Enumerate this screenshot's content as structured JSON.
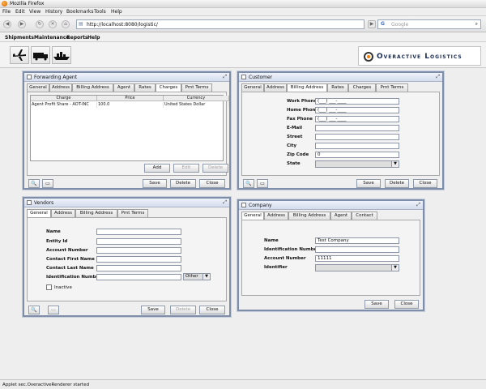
{
  "browser": {
    "window_title": "Mozilla Firefox",
    "menu": [
      "File",
      "Edit",
      "View",
      "History",
      "Bookmarks",
      "Tools",
      "Help"
    ],
    "url": "http://localhost:8080/logistic/",
    "search_placeholder": "Google"
  },
  "app": {
    "menu": [
      "Shipments",
      "Maintenance",
      "Reports",
      "Help"
    ],
    "logo_text": "Overactive Logistics",
    "toolbar_icons": [
      "airplane-icon",
      "truck-icon",
      "ship-icon"
    ]
  },
  "forwarding_agent": {
    "title": "Forwarding Agent",
    "tabs": [
      "General",
      "Address",
      "Billing Address",
      "Agent",
      "Rates",
      "Charges",
      "Pmt Terms"
    ],
    "selected_tab": "Charges",
    "columns": [
      "Charge",
      "Price",
      "Currency"
    ],
    "rows": [
      [
        "Agent Profit Share - AOT-INC",
        "100.0",
        "United States Dollar"
      ]
    ],
    "buttons": {
      "add": "Add",
      "edit": "Edit",
      "delete": "Delete"
    },
    "footer": {
      "save": "Save",
      "delete": "Delete",
      "close": "Close"
    }
  },
  "customer": {
    "title": "Customer",
    "tabs": [
      "General",
      "Address",
      "Billing Address",
      "Rates",
      "Charges",
      "Pmt Terms"
    ],
    "selected_tab": "Billing Address",
    "fields": {
      "work_phone_label": "Work Phone",
      "work_phone_value": "(___) ___-____",
      "home_phone_label": "Home Phone",
      "home_phone_value": "(___) ___-____",
      "fax_phone_label": "Fax Phone",
      "fax_phone_value": "(___) ___-____",
      "email_label": "E-Mail",
      "street_label": "Street",
      "city_label": "City",
      "zip_label": "Zip Code",
      "zip_value": "0",
      "state_label": "State"
    },
    "footer": {
      "save": "Save",
      "delete": "Delete",
      "close": "Close"
    }
  },
  "vendors": {
    "title": "Vendors",
    "tabs": [
      "General",
      "Address",
      "Billing Address",
      "Pmt Terms"
    ],
    "selected_tab": "General",
    "fields": {
      "name_label": "Name",
      "entity_id_label": "Entity Id",
      "account_number_label": "Account Number",
      "contact_first_label": "Contact First Name",
      "contact_last_label": "Contact Last Name",
      "identification_label": "Identification Number",
      "identification_type": "Other",
      "inactive_label": "Inactive"
    },
    "footer": {
      "save": "Save",
      "delete": "Delete",
      "close": "Close"
    }
  },
  "company": {
    "title": "Company",
    "tabs": [
      "General",
      "Address",
      "Billing Address",
      "Agent",
      "Contact"
    ],
    "selected_tab": "General",
    "fields": {
      "name_label": "Name",
      "name_value": "Test Company",
      "identification_label": "Identification Number",
      "account_number_label": "Account Number",
      "account_number_value": "11111",
      "identifier_label": "Identifier"
    },
    "footer": {
      "save": "Save",
      "close": "Close"
    }
  },
  "status_text": "Applet sec.OveractiveRenderer started"
}
